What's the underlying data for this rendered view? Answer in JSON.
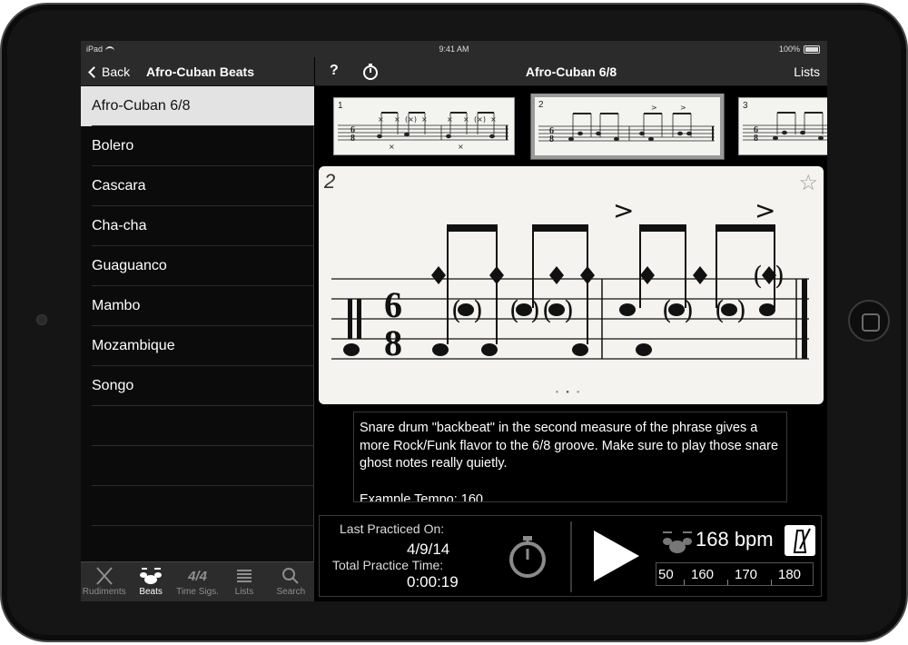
{
  "status_bar": {
    "carrier": "iPad",
    "time": "9:41 AM",
    "battery": "100%"
  },
  "sidebar": {
    "back_label": "Back",
    "title": "Afro-Cuban Beats",
    "items": [
      {
        "label": "Afro-Cuban 6/8",
        "selected": true
      },
      {
        "label": "Bolero"
      },
      {
        "label": "Cascara"
      },
      {
        "label": "Cha-cha"
      },
      {
        "label": "Guaguanco"
      },
      {
        "label": "Mambo"
      },
      {
        "label": "Mozambique"
      },
      {
        "label": "Songo"
      }
    ],
    "tabs": [
      {
        "label": "Rudiments",
        "icon": "rudiments-icon"
      },
      {
        "label": "Beats",
        "icon": "drum-set-icon",
        "active": true
      },
      {
        "label": "Time Sigs.",
        "icon": "time-signature-icon",
        "icon_text": "4/4"
      },
      {
        "label": "Lists",
        "icon": "list-icon"
      },
      {
        "label": "Search",
        "icon": "search-icon"
      }
    ]
  },
  "main": {
    "help_label": "?",
    "title": "Afro-Cuban 6/8",
    "lists_label": "Lists",
    "thumbnails": [
      {
        "number": "1"
      },
      {
        "number": "2",
        "selected": true
      },
      {
        "number": "3"
      }
    ],
    "notation": {
      "number": "2",
      "time_sig_top": "6",
      "time_sig_bottom": "8"
    },
    "description": {
      "text": "Snare drum \"backbeat\" in the second measure of the phrase gives a more Rock/Funk flavor to the 6/8 groove. Make sure to play those snare ghost notes really quietly.",
      "tempo": "Example Tempo: 160"
    },
    "practice": {
      "last_practiced_label": "Last Practiced On:",
      "last_practiced_date": "4/9/14",
      "total_time_label": "Total Practice Time:",
      "total_time": "0:00:19",
      "bpm": "168 bpm",
      "tempo_ticks": [
        "50",
        "160",
        "170",
        "180"
      ]
    }
  },
  "colors": {
    "selected_row": "#e3e3e3",
    "paper": "#f4f3ef",
    "bar": "#2b2b2b"
  }
}
